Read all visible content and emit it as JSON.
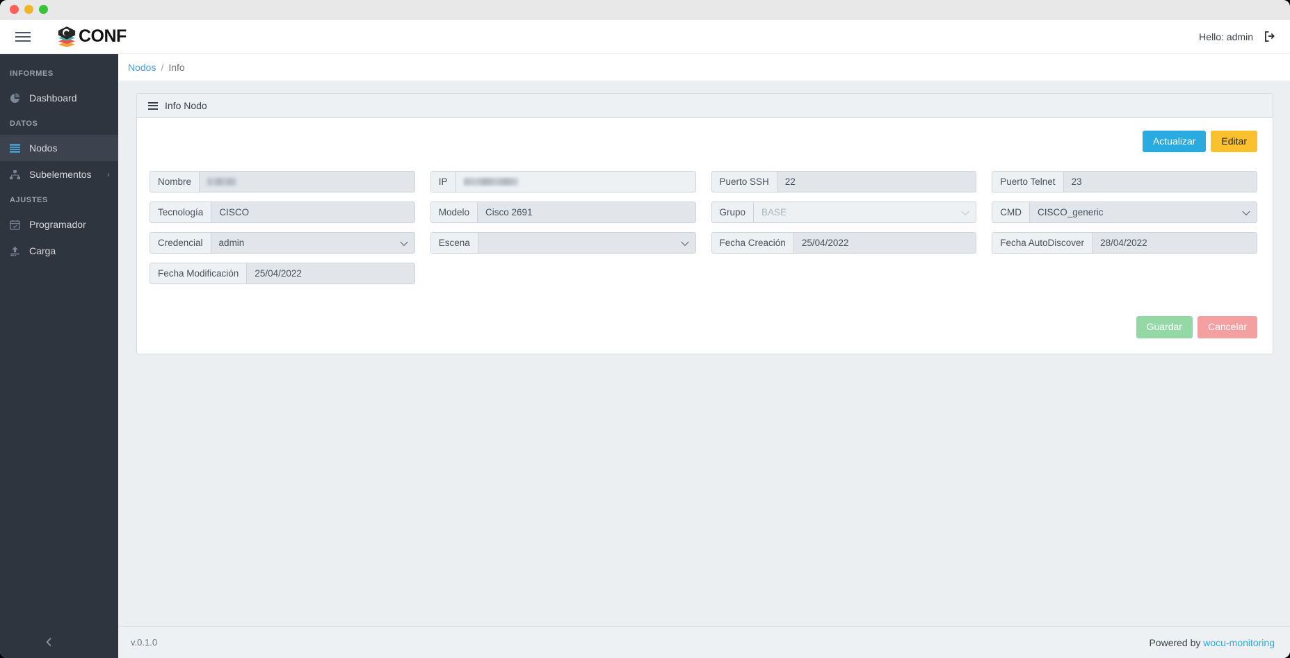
{
  "window": {
    "traffic_lights": [
      "close",
      "minimize",
      "maximize"
    ]
  },
  "navbar": {
    "menu_toggle": "hamburger-icon",
    "brand": "CONF",
    "greeting": "Hello: admin",
    "logout_icon": "logout-icon"
  },
  "sidebar": {
    "sections": [
      {
        "title": "INFORMES",
        "items": [
          {
            "label": "Dashboard",
            "icon": "pie-chart-icon",
            "active": false,
            "caret": ""
          }
        ]
      },
      {
        "title": "DATOS",
        "items": [
          {
            "label": "Nodos",
            "icon": "list-icon",
            "active": true,
            "caret": ""
          },
          {
            "label": "Subelementos",
            "icon": "sitemap-icon",
            "active": false,
            "caret": "‹"
          }
        ]
      },
      {
        "title": "AJUSTES",
        "items": [
          {
            "label": "Programador",
            "icon": "calendar-check-icon",
            "active": false,
            "caret": ""
          },
          {
            "label": "Carga",
            "icon": "upload-icon",
            "active": false,
            "caret": ""
          }
        ]
      }
    ],
    "collapse_icon": "chevron-left-icon"
  },
  "breadcrumb": {
    "root": "Nodos",
    "separator": "/",
    "current": "Info"
  },
  "card": {
    "title": "Info Nodo",
    "title_icon": "list-bars-icon",
    "actions": {
      "update": "Actualizar",
      "edit": "Editar"
    },
    "footer_actions": {
      "save": "Guardar",
      "cancel": "Cancelar"
    }
  },
  "form": {
    "fields": [
      {
        "label": "Nombre",
        "value": "",
        "type": "text",
        "state": "filled",
        "redacted": true,
        "redact_width": 42
      },
      {
        "label": "IP",
        "value": "",
        "type": "text",
        "state": "light",
        "redacted": true,
        "redact_width": 78
      },
      {
        "label": "Puerto SSH",
        "value": "22",
        "type": "text",
        "state": "filled",
        "redacted": false
      },
      {
        "label": "Puerto Telnet",
        "value": "23",
        "type": "text",
        "state": "filled",
        "redacted": false
      },
      {
        "label": "Tecnología",
        "value": "CISCO",
        "type": "text",
        "state": "filled",
        "redacted": false
      },
      {
        "label": "Modelo",
        "value": "Cisco 2691",
        "type": "text",
        "state": "filled",
        "redacted": false
      },
      {
        "label": "Grupo",
        "value": "BASE",
        "type": "select",
        "state": "light",
        "redacted": false
      },
      {
        "label": "CMD",
        "value": "CISCO_generic",
        "type": "select",
        "state": "filled",
        "redacted": false
      },
      {
        "label": "Credencial",
        "value": "admin",
        "type": "select",
        "state": "filled",
        "redacted": false
      },
      {
        "label": "Escena",
        "value": "",
        "type": "select",
        "state": "filled",
        "redacted": false
      },
      {
        "label": "Fecha Creación",
        "value": "25/04/2022",
        "type": "text",
        "state": "filled",
        "redacted": false
      },
      {
        "label": "Fecha AutoDiscover",
        "value": "28/04/2022",
        "type": "text",
        "state": "filled",
        "redacted": false
      },
      {
        "label": "Fecha Modificación",
        "value": "25/04/2022",
        "type": "text",
        "state": "filled",
        "redacted": false
      }
    ]
  },
  "footer": {
    "version": "v.0.1.0",
    "powered_prefix": "Powered by ",
    "powered_link": "wocu-monitoring"
  },
  "colors": {
    "accent_blue": "#29abe2",
    "edit_yellow": "#fbc02d",
    "save_green": "#94d8a5",
    "cancel_red": "#f4a0a0",
    "sidebar_bg": "#2f353f",
    "content_bg": "#eceff1"
  }
}
